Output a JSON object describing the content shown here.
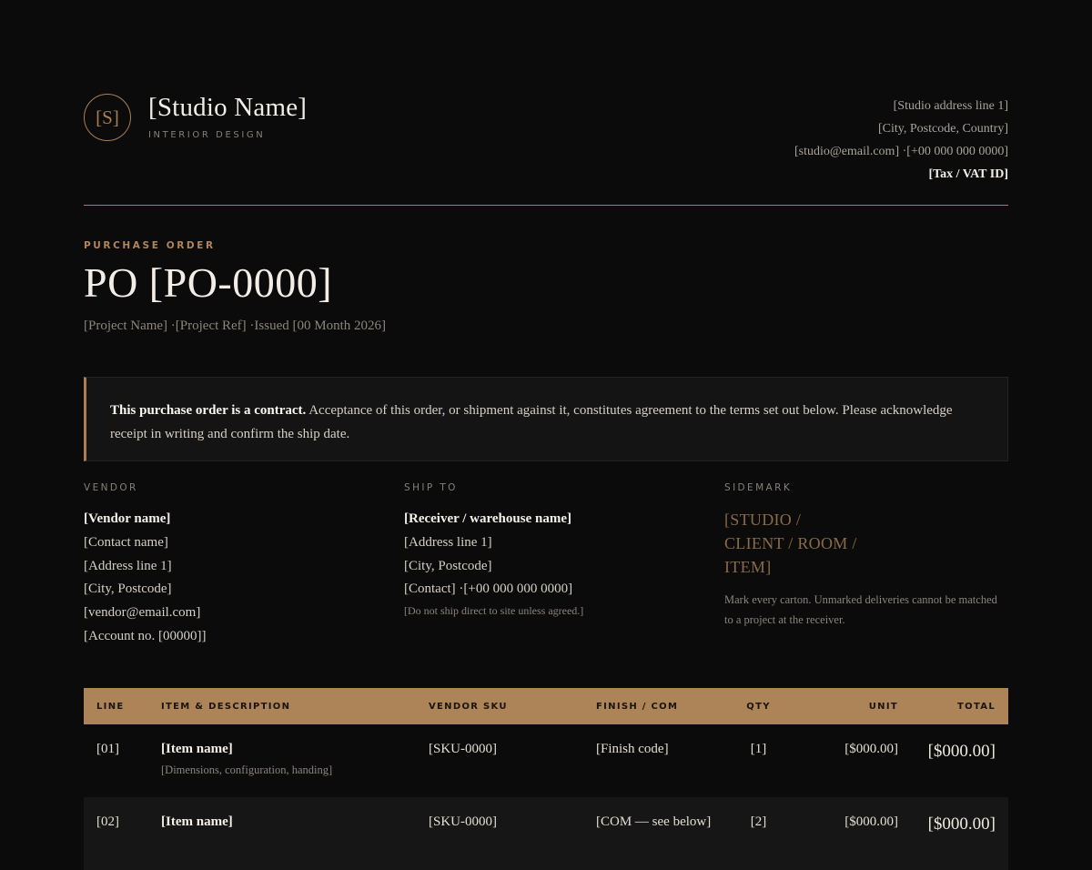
{
  "header": {
    "logo_monogram": "[S]",
    "studio_name": "[Studio Name]",
    "tagline": "INTERIOR DESIGN",
    "address_line1": "[Studio address line 1]",
    "address_line2": "[City, Postcode, Country]",
    "contact_line": "[studio@email.com] ·[+00 000 000 0000]",
    "tax_id": "[Tax / VAT ID]"
  },
  "title": {
    "eyebrow": "PURCHASE ORDER",
    "po_number": "PO [PO-0000]",
    "meta": "[Project Name] ·[Project Ref] ·Issued [00 Month 2026]"
  },
  "notice": {
    "bold": "This purchase order is a contract.",
    "text": " Acceptance of this order, or shipment against it, constitutes agreement to the terms set out below. Please acknowledge receipt in writing and confirm the ship date."
  },
  "vendor": {
    "heading": "VENDOR",
    "name": "[Vendor name]",
    "contact": "[Contact name]",
    "address": "[Address line 1]",
    "city": "[City, Postcode]",
    "email": "[vendor@email.com]",
    "account": "[Account no. [00000]]"
  },
  "ship_to": {
    "heading": "SHIP TO",
    "name": "[Receiver / warehouse name]",
    "address": "[Address line 1]",
    "city": "[City, Postcode]",
    "contact": "[Contact] ·[+00 000 000 0000]",
    "note": "[Do not ship direct to site unless agreed.]"
  },
  "sidemark": {
    "heading": "SIDEMARK",
    "value": "[STUDIO / CLIENT / ROOM / ITEM]",
    "note": "Mark every carton. Unmarked deliveries cannot be matched to a project at the receiver."
  },
  "table": {
    "columns": [
      "LINE",
      "ITEM & DESCRIPTION",
      "VENDOR SKU",
      "FINISH / COM",
      "QTY",
      "UNIT",
      "TOTAL"
    ],
    "rows": [
      {
        "line": "[01]",
        "item": "[Item name]",
        "desc": "[Dimensions, configuration, handing]",
        "sku": "[SKU-0000]",
        "finish": "[Finish code]",
        "qty": "[1]",
        "unit": "[$000.00]",
        "total": "[$000.00]"
      },
      {
        "line": "[02]",
        "item": "[Item name]",
        "desc": "",
        "sku": "[SKU-0000]",
        "finish": "[COM — see below]",
        "qty": "[2]",
        "unit": "[$000.00]",
        "total": "[$000.00]"
      }
    ]
  }
}
